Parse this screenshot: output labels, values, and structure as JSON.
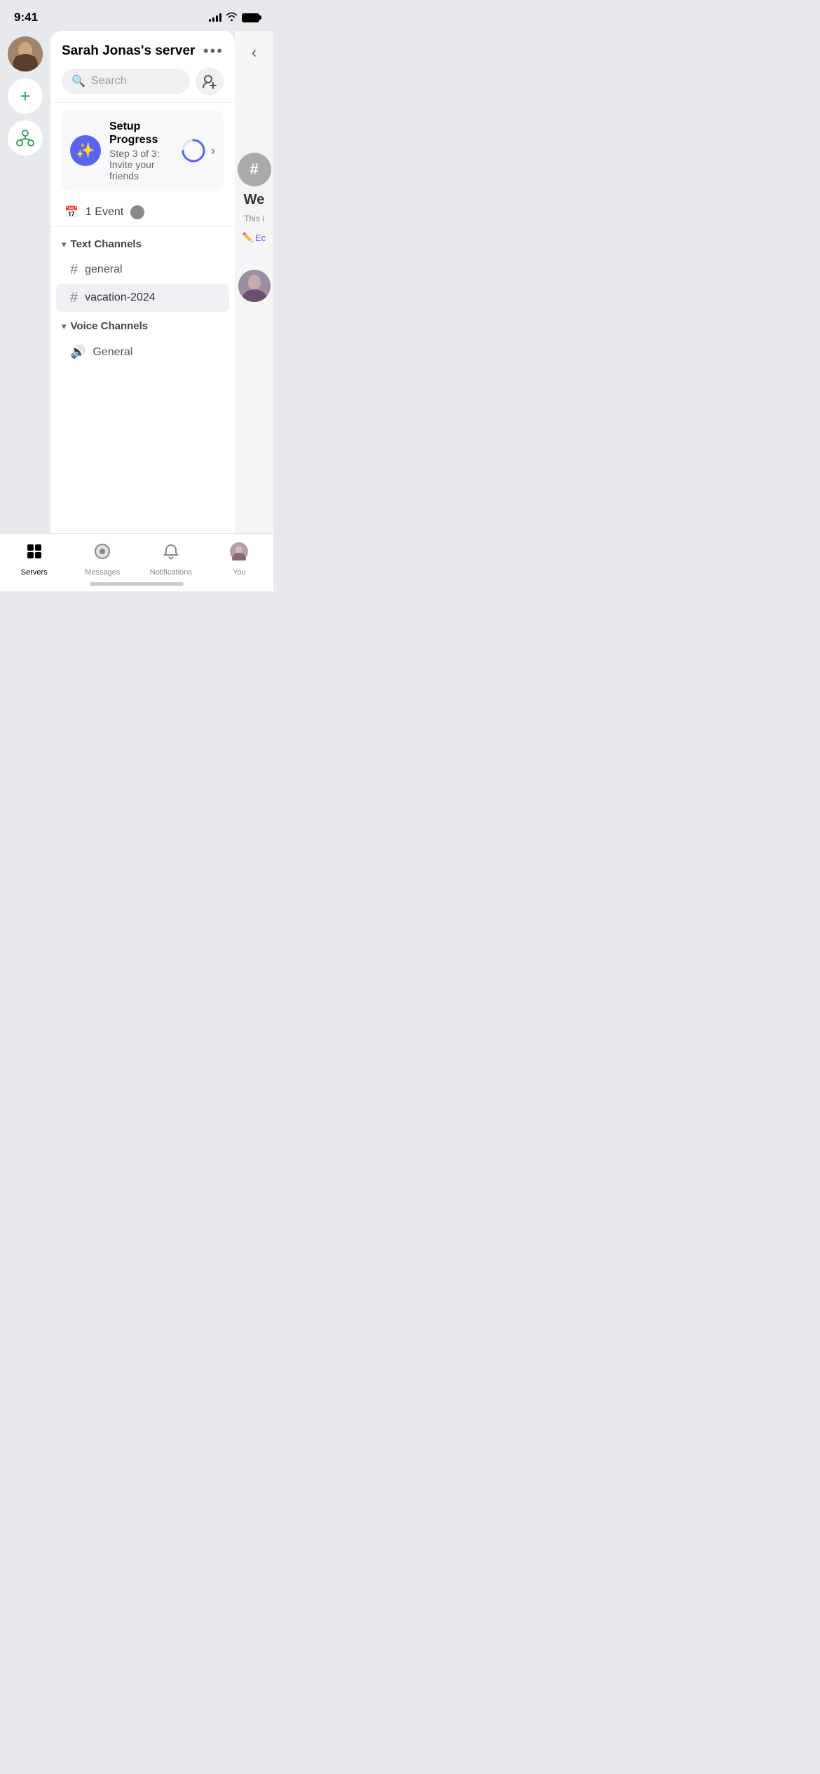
{
  "statusBar": {
    "time": "9:41"
  },
  "serverSidebar": {
    "add_button_label": "+",
    "add_button_aria": "Add server"
  },
  "serverPanel": {
    "title": "Sarah Jonas's server",
    "more_button": "•••",
    "search": {
      "placeholder": "Search"
    },
    "invite_button_aria": "Invite member",
    "setupProgress": {
      "title": "Setup Progress",
      "step": "Step 3 of 3:",
      "description": "Invite your friends"
    },
    "events": {
      "label": "1 Event"
    },
    "textChannels": {
      "header": "Text Channels",
      "channels": [
        {
          "name": "general",
          "active": false
        },
        {
          "name": "vacation-2024",
          "active": true
        }
      ]
    },
    "voiceChannels": {
      "header": "Voice Channels",
      "channels": [
        {
          "name": "General"
        }
      ]
    }
  },
  "rightPanelPeek": {
    "channel_title": "We",
    "channel_subtitle": "This i",
    "edit_label": "Ec"
  },
  "bottomNav": {
    "items": [
      {
        "id": "servers",
        "label": "Servers",
        "active": true
      },
      {
        "id": "messages",
        "label": "Messages",
        "active": false
      },
      {
        "id": "notifications",
        "label": "Notifications",
        "active": false
      },
      {
        "id": "you",
        "label": "You",
        "active": false
      }
    ]
  }
}
